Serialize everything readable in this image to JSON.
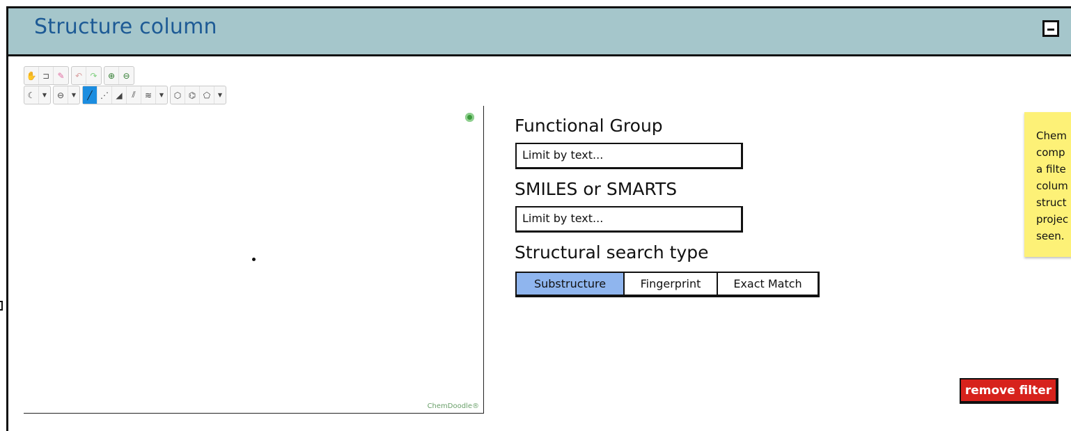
{
  "panel": {
    "title": "Structure column"
  },
  "editor": {
    "credit": "ChemDoodle®"
  },
  "filters": {
    "functional_group": {
      "label": "Functional Group",
      "placeholder": "Limit by text..."
    },
    "smiles": {
      "label": "SMILES or SMARTS",
      "placeholder": "Limit by text..."
    },
    "search_type": {
      "label": "Structural search type",
      "options": [
        "Substructure",
        "Fingerprint",
        "Exact Match"
      ],
      "selected": "Substructure"
    }
  },
  "note": {
    "lines": [
      "Chem",
      "comp",
      "a filte",
      "colum",
      "struct",
      "projec",
      "seen."
    ]
  },
  "actions": {
    "remove_filter": "remove filter"
  },
  "colors": {
    "header_bg": "#a5c6cb",
    "title": "#1d5a95",
    "selected_option": "#8fb5ee",
    "note_bg": "#fdf177",
    "danger": "#d7221c"
  }
}
